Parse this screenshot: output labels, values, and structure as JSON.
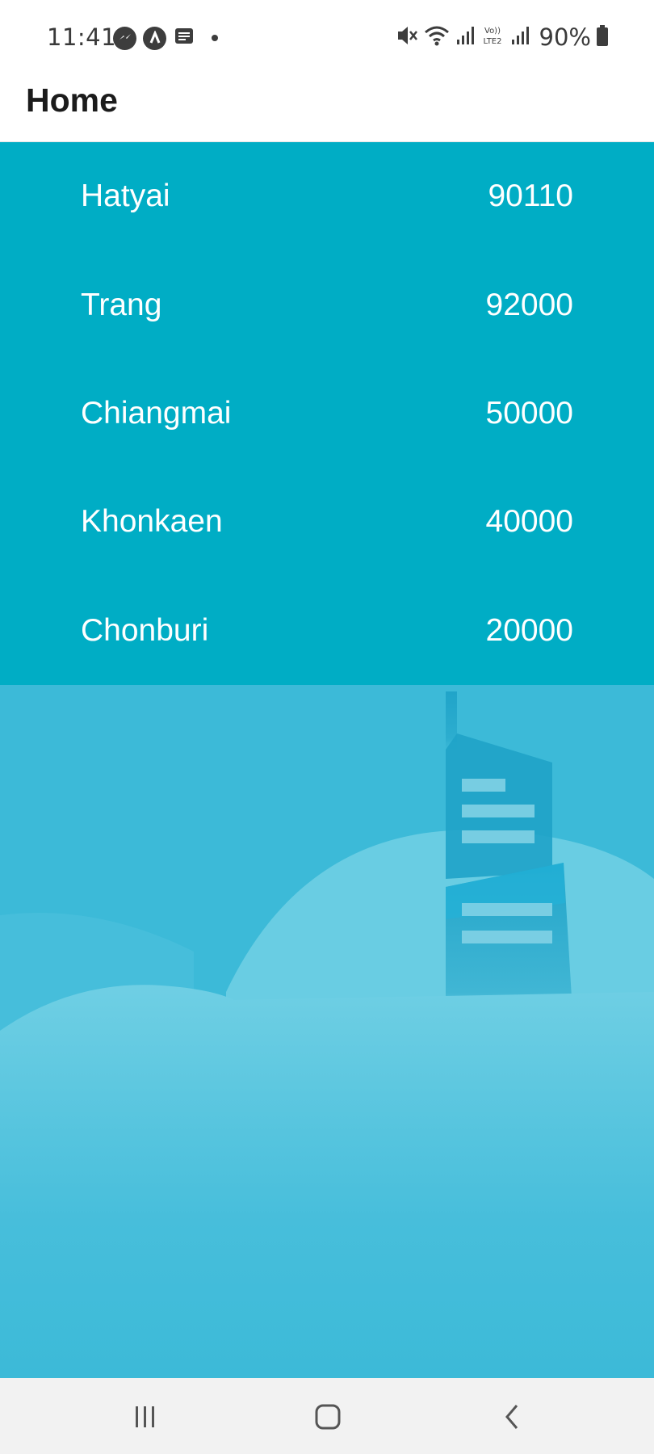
{
  "status_bar": {
    "time": "11:41",
    "battery": "90%",
    "notification_icons": [
      "messenger-icon",
      "alert-app-icon",
      "message-icon"
    ],
    "system_icons": [
      "mute-icon",
      "wifi-icon",
      "signal-icon",
      "volte-icon",
      "signal-icon",
      "battery-icon"
    ]
  },
  "app_bar": {
    "title": "Home"
  },
  "cities": [
    {
      "name": "Hatyai",
      "code": "90110"
    },
    {
      "name": "Trang",
      "code": "92000"
    },
    {
      "name": "Chiangmai",
      "code": "50000"
    },
    {
      "name": "Khonkaen",
      "code": "40000"
    },
    {
      "name": "Chonburi",
      "code": "20000"
    }
  ],
  "colors": {
    "list_background": "#00adc5",
    "illustration_background": "#3cbad8",
    "nav_background": "#f2f2f2"
  },
  "nav": {
    "buttons": [
      "recents-icon",
      "home-icon",
      "back-icon"
    ]
  }
}
